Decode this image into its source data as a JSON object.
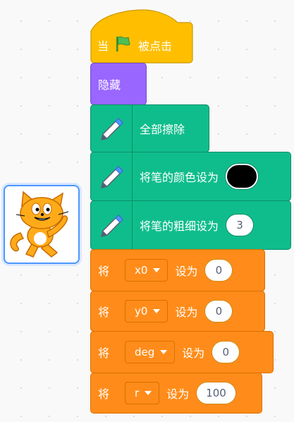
{
  "hat": {
    "when": "当",
    "clicked": "被点击",
    "flag_icon": "green-flag-icon"
  },
  "looks": {
    "hide": "隐藏"
  },
  "pen": {
    "clear": "全部擦除",
    "set_color": "将笔的颜色设为",
    "pen_color": "#000000",
    "set_size": "将笔的粗细设为",
    "size_value": "3"
  },
  "vars": [
    {
      "prefix": "将",
      "name": "x0",
      "to": "设为",
      "value": "0"
    },
    {
      "prefix": "将",
      "name": "y0",
      "to": "设为",
      "value": "0"
    },
    {
      "prefix": "将",
      "name": "deg",
      "to": "设为",
      "value": "0"
    },
    {
      "prefix": "将",
      "name": "r",
      "to": "设为",
      "value": "100"
    }
  ],
  "colors": {
    "events": "#ffbf00",
    "looks": "#9966ff",
    "pen": "#0fbd8c",
    "variables": "#ff8c1a",
    "sprite_border": "#4c97ff"
  }
}
